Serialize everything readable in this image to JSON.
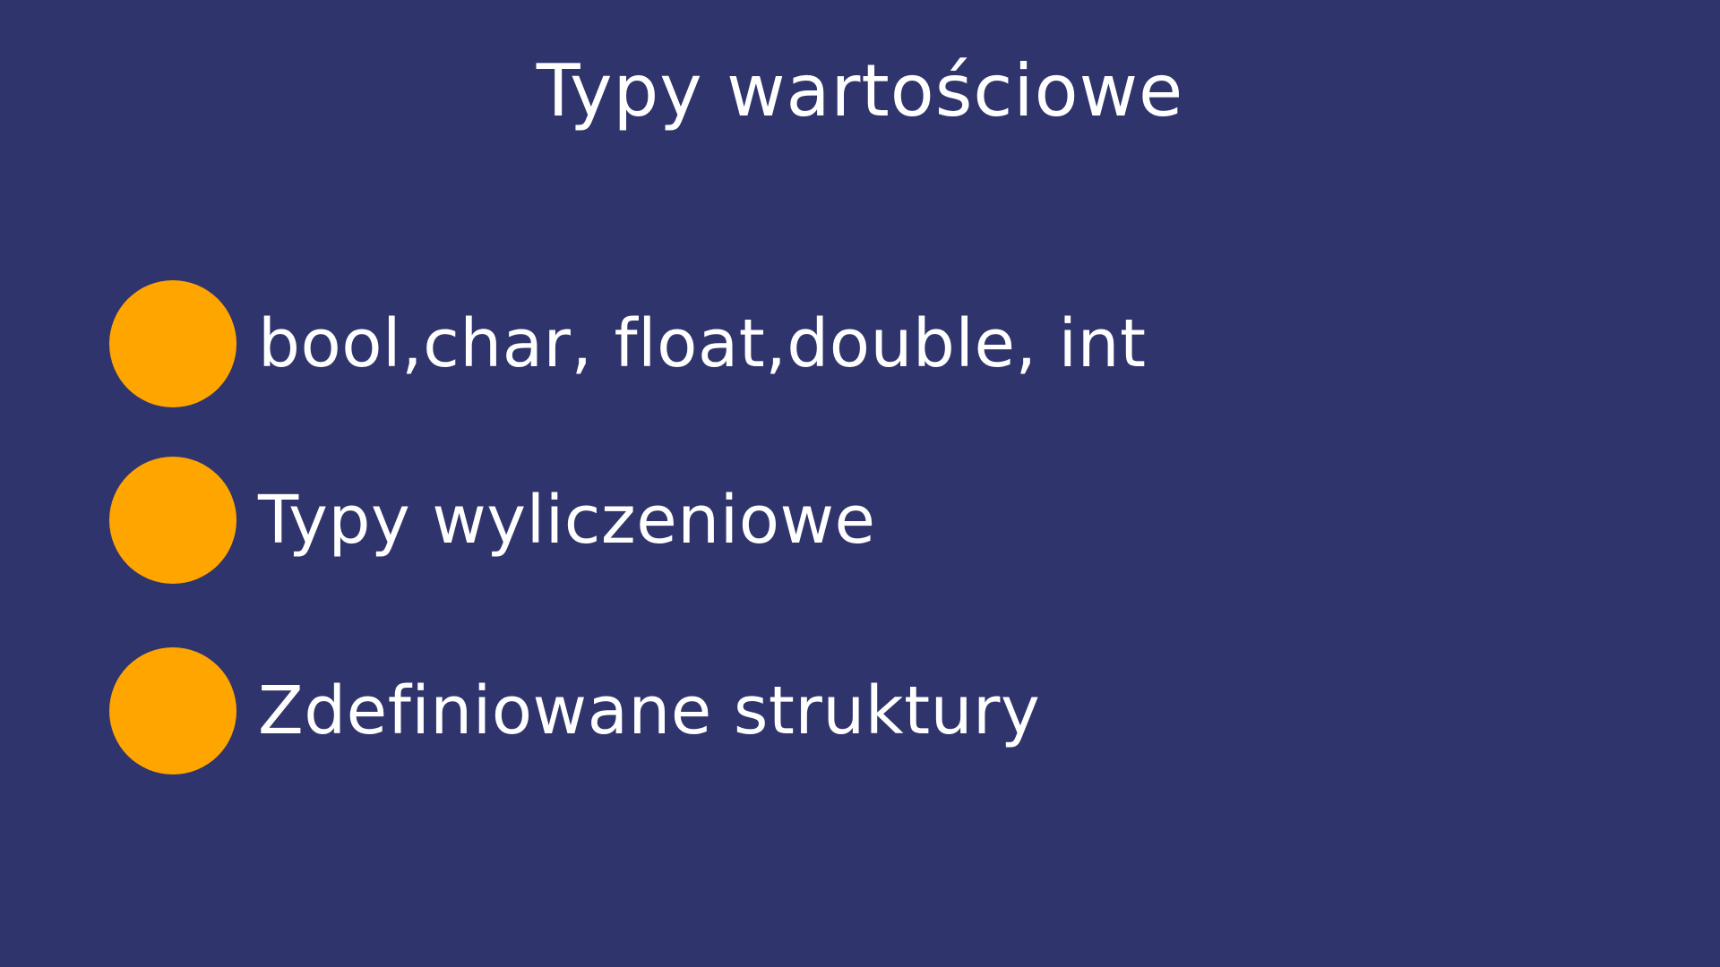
{
  "slide": {
    "title": "Typy wartościowe",
    "bullets": [
      {
        "text": "bool,char, float,double, int"
      },
      {
        "text": "Typy wyliczeniowe"
      },
      {
        "text": "Zdefiniowane struktury"
      }
    ],
    "colors": {
      "background": "#30346c",
      "bullet": "#ffa500",
      "text": "#ffffff"
    }
  }
}
